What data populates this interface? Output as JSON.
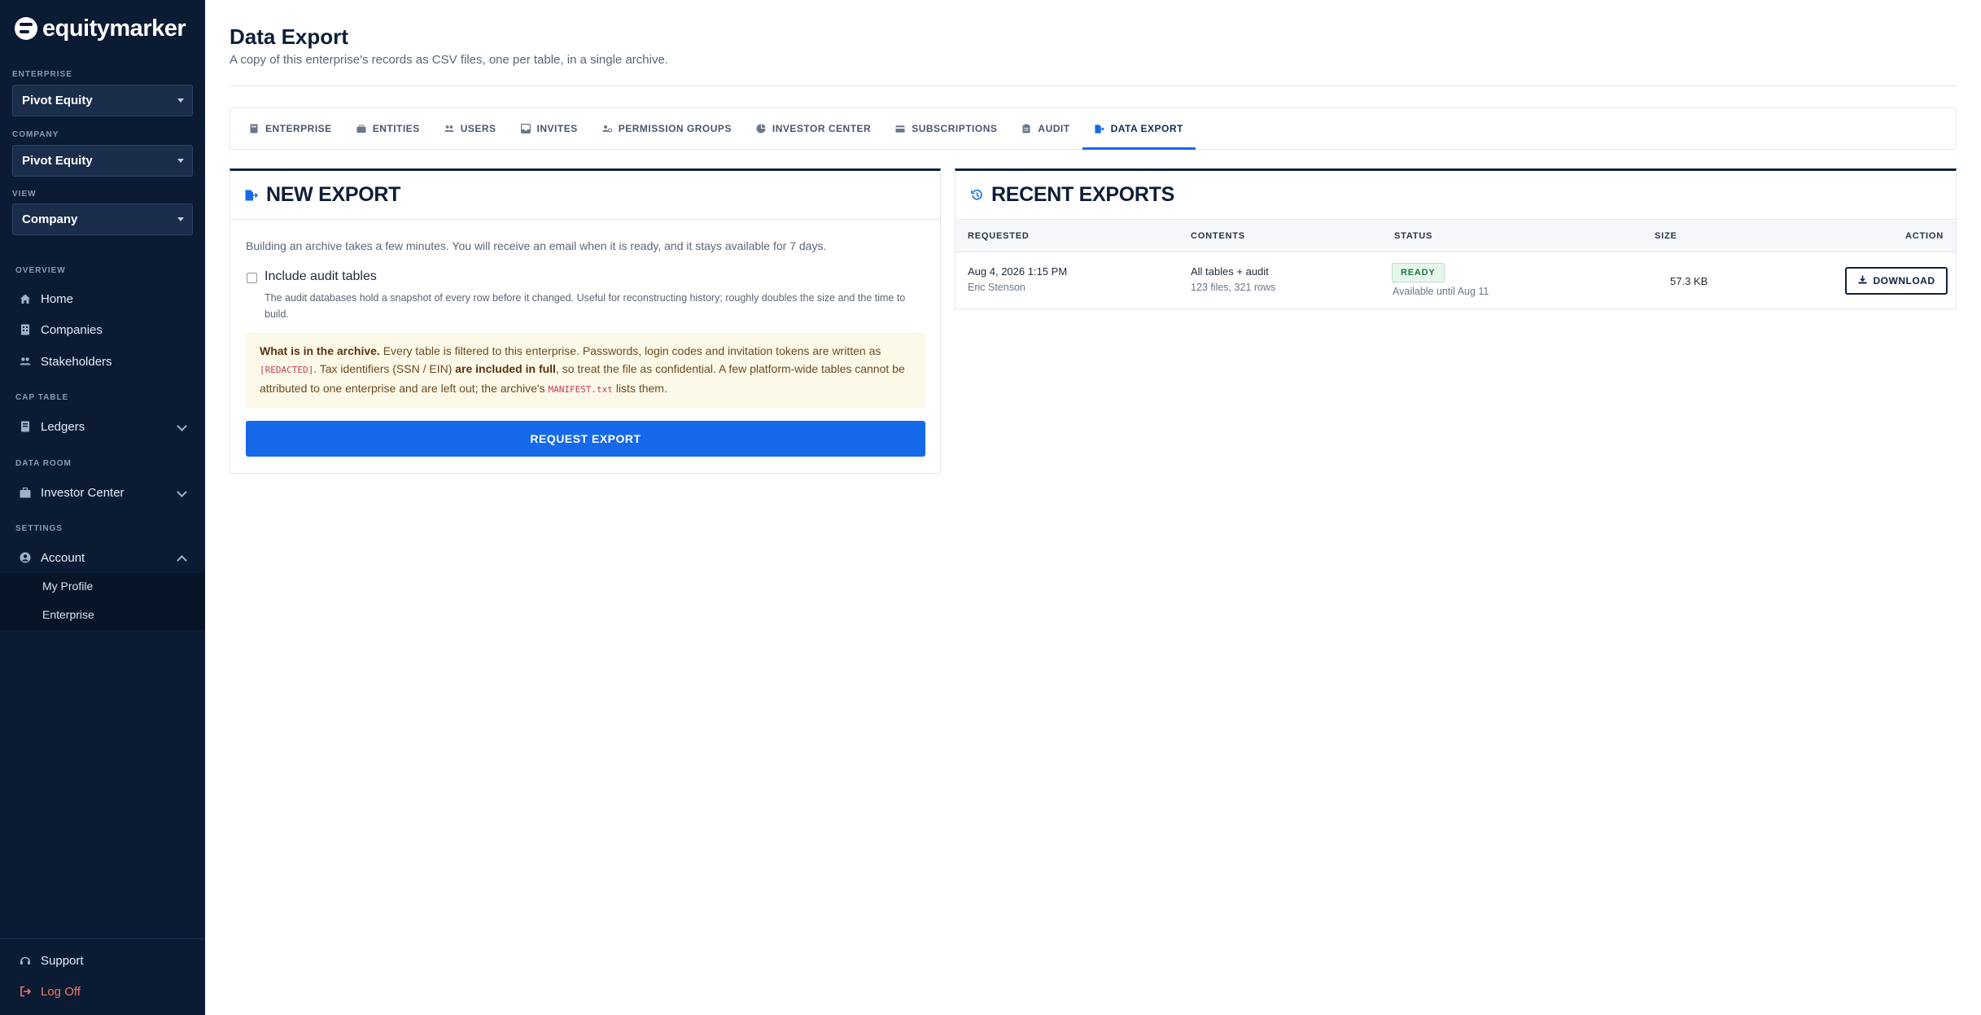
{
  "brand": {
    "name": "equitymarker"
  },
  "selectors": [
    {
      "label": "ENTERPRISE",
      "value": "Pivot Equity"
    },
    {
      "label": "COMPANY",
      "value": "Pivot Equity"
    },
    {
      "label": "VIEW",
      "value": "Company"
    }
  ],
  "nav": {
    "overview_label": "OVERVIEW",
    "home": "Home",
    "companies": "Companies",
    "stakeholders": "Stakeholders",
    "cap_table_label": "CAP TABLE",
    "ledgers": "Ledgers",
    "data_room_label": "DATA ROOM",
    "investor_center": "Investor Center",
    "settings_label": "SETTINGS",
    "account": "Account",
    "my_profile": "My Profile",
    "enterprise": "Enterprise",
    "support": "Support",
    "log_off": "Log Off"
  },
  "page": {
    "title": "Data Export",
    "subtitle": "A copy of this enterprise's records as CSV files, one per table, in a single archive."
  },
  "tabs": [
    {
      "label": "ENTERPRISE",
      "icon": "building-icon"
    },
    {
      "label": "ENTITIES",
      "icon": "briefcase-icon"
    },
    {
      "label": "USERS",
      "icon": "users-icon"
    },
    {
      "label": "INVITES",
      "icon": "inbox-icon"
    },
    {
      "label": "PERMISSION GROUPS",
      "icon": "user-cog-icon"
    },
    {
      "label": "INVESTOR CENTER",
      "icon": "chart-pie-icon"
    },
    {
      "label": "SUBSCRIPTIONS",
      "icon": "credit-card-icon"
    },
    {
      "label": "AUDIT",
      "icon": "clipboard-icon"
    },
    {
      "label": "DATA EXPORT",
      "icon": "file-export-icon",
      "active": true
    }
  ],
  "new_export": {
    "title": "NEW EXPORT",
    "info": "Building an archive takes a few minutes. You will receive an email when it is ready, and it stays available for 7 days.",
    "checkbox_label": "Include audit tables",
    "checkbox_checked": false,
    "checkbox_help": "The audit databases hold a snapshot of every row before it changed. Useful for reconstructing history; roughly doubles the size and the time to build.",
    "notice": {
      "lead": "What is in the archive.",
      "p1": " Every table is filtered to this enterprise. Passwords, login codes and invitation tokens are written as ",
      "code1": "[REDACTED]",
      "p2": ". Tax identifiers (SSN / EIN) ",
      "strong": "are included in full",
      "p3": ", so treat the file as confidential. A few platform-wide tables cannot be attributed to one enterprise and are left out; the archive's ",
      "code2": "MANIFEST.txt",
      "p4": " lists them."
    },
    "button": "REQUEST EXPORT"
  },
  "recent_exports": {
    "title": "RECENT EXPORTS",
    "columns": {
      "requested": "REQUESTED",
      "contents": "CONTENTS",
      "status": "STATUS",
      "size": "SIZE",
      "action": "ACTION"
    },
    "rows": [
      {
        "requested": "Aug 4, 2026 1:15 PM",
        "requested_by": "Eric Stenson",
        "contents": "All tables + audit",
        "contents_sub": "123 files, 321 rows",
        "status": "READY",
        "status_sub": "Available until Aug 11",
        "size": "57.3 KB",
        "action": "DOWNLOAD"
      }
    ]
  },
  "colors": {
    "sidebar": "#0b1b33",
    "accent": "#1669e8",
    "ready": "#1f7a3f",
    "logoff": "#f07a6a"
  }
}
